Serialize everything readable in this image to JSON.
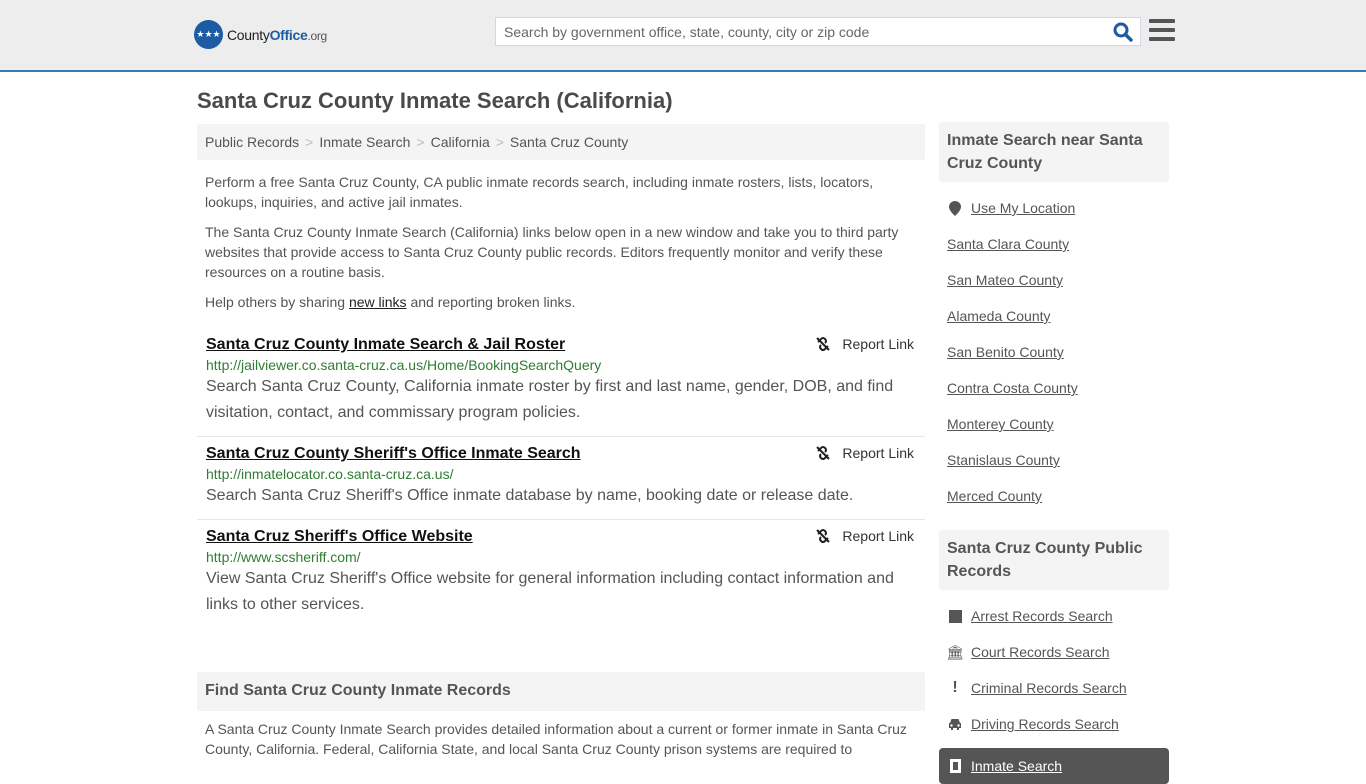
{
  "header": {
    "logo": {
      "brand_part1": "County",
      "brand_part2": "Office",
      "brand_tld": ".org"
    },
    "search": {
      "placeholder": "Search by government office, state, county, city or zip code",
      "value": ""
    },
    "colors": {
      "accent": "#3a79b5",
      "brand": "#1d5ca3"
    }
  },
  "page": {
    "title": "Santa Cruz County Inmate Search (California)"
  },
  "breadcrumb": [
    {
      "label": "Public Records"
    },
    {
      "label": "Inmate Search"
    },
    {
      "label": "California"
    },
    {
      "label": "Santa Cruz County"
    }
  ],
  "intro": {
    "p1": "Perform a free Santa Cruz County, CA public inmate records search, including inmate rosters, lists, locators, lookups, inquiries, and active jail inmates.",
    "p2": "The Santa Cruz County Inmate Search (California) links below open in a new window and take you to third party websites that provide access to Santa Cruz County public records. Editors frequently monitor and verify these resources on a routine basis.",
    "p3_before": "Help others by sharing ",
    "p3_link": "new links",
    "p3_after": " and reporting broken links."
  },
  "results": [
    {
      "title": "Santa Cruz County Inmate Search & Jail Roster",
      "url": "http://jailviewer.co.santa-cruz.ca.us/Home/BookingSearchQuery",
      "description": "Search Santa Cruz County, California inmate roster by first and last name, gender, DOB, and find visitation, contact, and commissary program policies.",
      "report_label": "Report Link"
    },
    {
      "title": "Santa Cruz County Sheriff's Office Inmate Search",
      "url": "http://inmatelocator.co.santa-cruz.ca.us/",
      "description": "Search Santa Cruz Sheriff's Office inmate database by name, booking date or release date.",
      "report_label": "Report Link"
    },
    {
      "title": "Santa Cruz Sheriff's Office Website",
      "url": "http://www.scsheriff.com/",
      "description": "View Santa Cruz Sheriff's Office website for general information including contact information and links to other services.",
      "report_label": "Report Link"
    }
  ],
  "find_section": {
    "heading": "Find Santa Cruz County Inmate Records",
    "body": "A Santa Cruz County Inmate Search provides detailed information about a current or former inmate in Santa Cruz County, California. Federal, California State, and local Santa Cruz County prison systems are required to"
  },
  "sidebar": {
    "nearby": {
      "heading": "Inmate Search near Santa Cruz County",
      "use_location": "Use My Location",
      "items": [
        "Santa Clara County",
        "San Mateo County",
        "Alameda County",
        "San Benito County",
        "Contra Costa County",
        "Monterey County",
        "Stanislaus County",
        "Merced County"
      ]
    },
    "public_records": {
      "heading": "Santa Cruz County Public Records",
      "items": [
        {
          "label": "Arrest Records Search",
          "icon": "square-icon"
        },
        {
          "label": "Court Records Search",
          "icon": "courthouse-icon"
        },
        {
          "label": "Criminal Records Search",
          "icon": "exclamation-icon"
        },
        {
          "label": "Driving Records Search",
          "icon": "car-icon"
        }
      ],
      "active": {
        "label": "Inmate Search",
        "icon": "door-icon"
      }
    }
  }
}
